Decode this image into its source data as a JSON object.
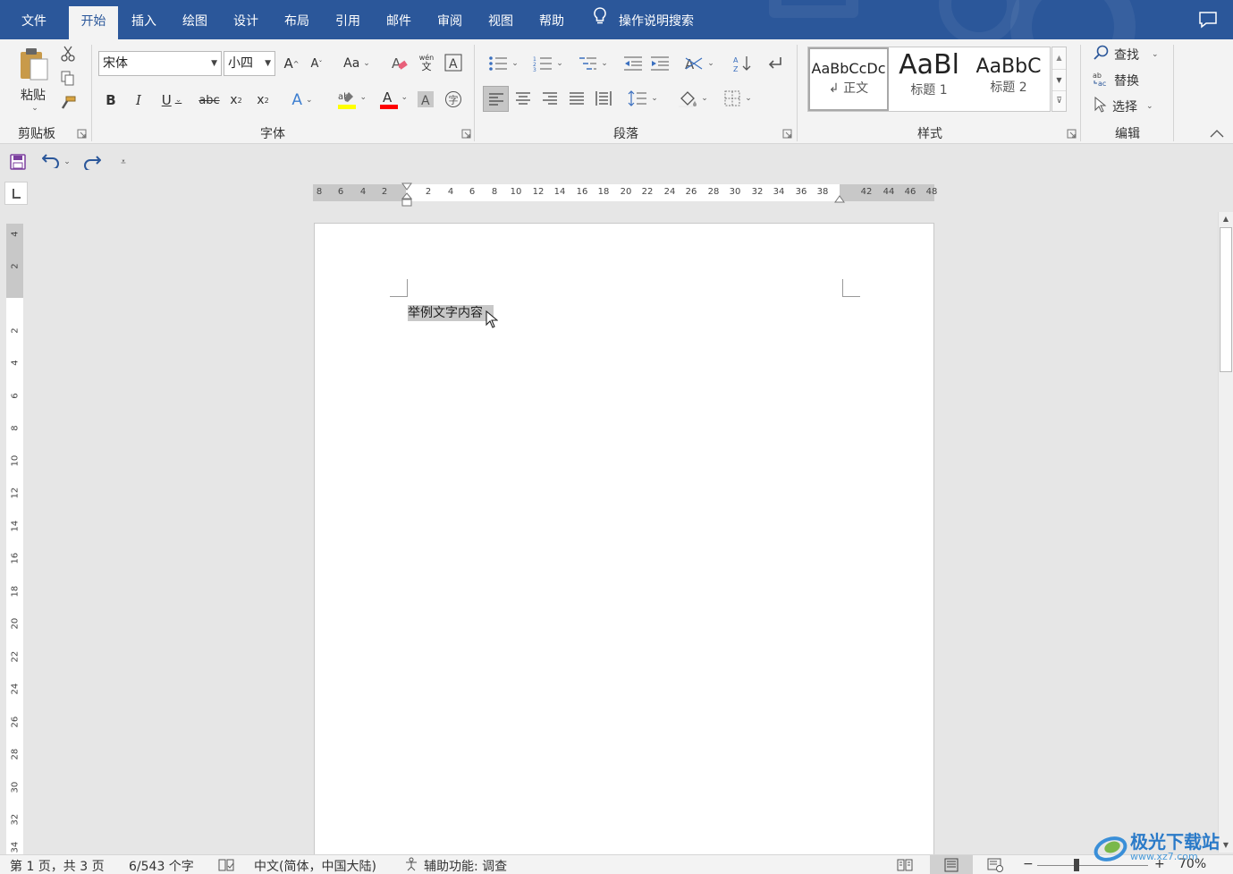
{
  "tabs": [
    {
      "label": "文件"
    },
    {
      "label": "开始"
    },
    {
      "label": "插入"
    },
    {
      "label": "绘图"
    },
    {
      "label": "设计"
    },
    {
      "label": "布局"
    },
    {
      "label": "引用"
    },
    {
      "label": "邮件"
    },
    {
      "label": "审阅"
    },
    {
      "label": "视图"
    },
    {
      "label": "帮助"
    }
  ],
  "active_tab": "开始",
  "tell_me": {
    "label": "操作说明搜索",
    "icon": "lightbulb-icon"
  },
  "ribbon": {
    "clipboard": {
      "label": "剪贴板",
      "paste_label": "粘贴"
    },
    "font": {
      "label": "字体",
      "font_name": "宋体",
      "font_size": "小四"
    },
    "paragraph": {
      "label": "段落"
    },
    "styles": {
      "label": "样式",
      "items": [
        {
          "preview": "AaBbCcDc",
          "name": "↲ 正文"
        },
        {
          "preview": "AaBl",
          "name": "标题 1"
        },
        {
          "preview": "AaBbC",
          "name": "标题 2"
        }
      ]
    },
    "editing": {
      "label": "编辑",
      "find": "查找",
      "replace": "替换",
      "select": "选择"
    }
  },
  "hruler_ticks": [
    "8",
    "6",
    "4",
    "2",
    "2",
    "4",
    "6",
    "8",
    "10",
    "12",
    "14",
    "16",
    "18",
    "20",
    "22",
    "24",
    "26",
    "28",
    "30",
    "32",
    "34",
    "36",
    "38",
    "42",
    "44",
    "46",
    "48"
  ],
  "vruler_ticks": [
    "4",
    "2",
    "2",
    "4",
    "6",
    "8",
    "10",
    "12",
    "14",
    "16",
    "18",
    "20",
    "22",
    "24",
    "26",
    "28",
    "30",
    "32",
    "34"
  ],
  "document": {
    "text": "举例文字内容"
  },
  "status": {
    "page": "第 1 页，共 3 页",
    "words": "6/543 个字",
    "language": "中文(简体，中国大陆)",
    "accessibility": "辅助功能: 调查",
    "zoom": "70%"
  },
  "watermark": {
    "text": "极光下载站",
    "url": "www.xz7.com"
  },
  "colors": {
    "accent": "#2b579a",
    "highlight": "#ffff00",
    "font_color": "#ff0000",
    "selection": "#c8c8c8"
  }
}
